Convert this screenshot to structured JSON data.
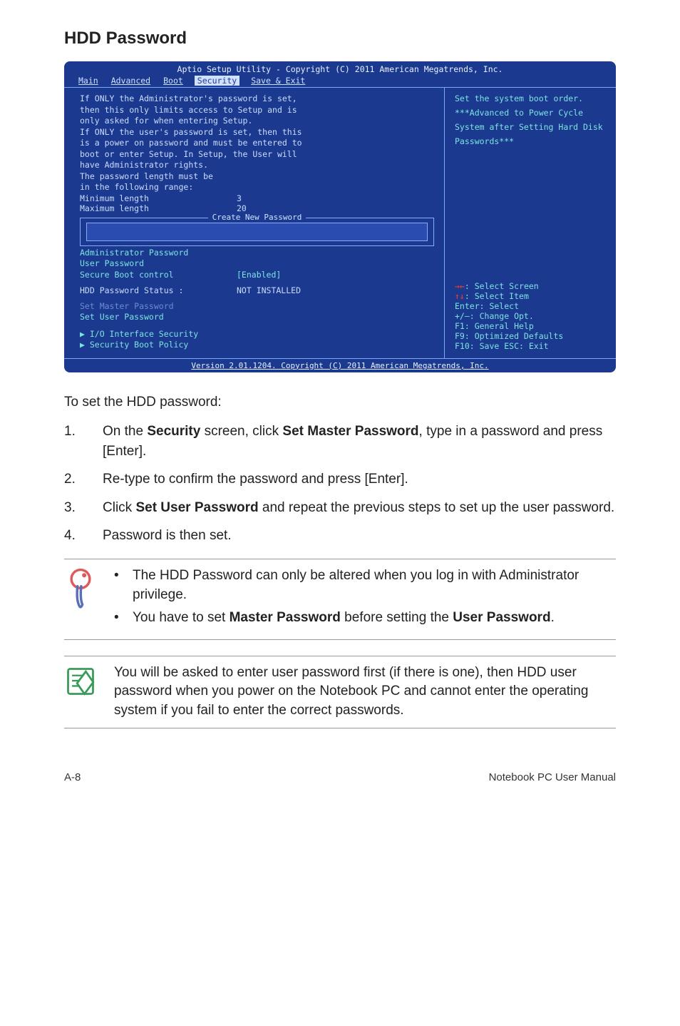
{
  "heading": "HDD Password",
  "bios": {
    "title": "Aptio Setup Utility - Copyright (C) 2011 American Megatrends, Inc.",
    "tabs": [
      "Main",
      "Advanced",
      "Boot",
      "Security",
      "Save & Exit"
    ],
    "active_tab": "Security",
    "info_lines": [
      "If ONLY the Administrator's password is set,",
      "then this only limits access to Setup and is",
      "only asked for when entering Setup.",
      "If ONLY the user's password is set, then this",
      "is a power on password and must be entered to",
      "boot or enter Setup. In Setup, the User will",
      "have Administrator rights.",
      "The password length must be",
      "in the following range:"
    ],
    "min_label": "Minimum length",
    "min_value": "3",
    "max_label": "Maximum length",
    "max_value": "20",
    "dialog_title": "Create New Password",
    "items": {
      "admin_pw": "Administrator Password",
      "user_pw": "User Password",
      "secure_boot_label": "Secure Boot control",
      "secure_boot_value": "[Enabled]",
      "hdd_status_label": "HDD Password Status :",
      "hdd_status_value": "NOT INSTALLED",
      "set_master": "Set Master Password",
      "set_user": "Set User Password",
      "io_security": "I/O Interface Security",
      "boot_policy": "Security Boot Policy"
    },
    "help": {
      "line1": "Set the system boot order.",
      "line2": "***Advanced to Power Cycle",
      "line3": "System after Setting Hard Disk",
      "line4": "Passwords***"
    },
    "keys": {
      "select_screen": "Select Screen",
      "select_item": "Select Item",
      "enter": "Enter: Select",
      "change": "+/—:  Change Opt.",
      "f1": "F1:   General Help",
      "f9": "F9:   Optimized Defaults",
      "f10": "F10:  Save   ESC: Exit"
    },
    "footer": "Version 2.01.1204. Copyright (C) 2011 American Megatrends, Inc."
  },
  "intro": "To set the HDD password:",
  "steps": [
    {
      "num": "1.",
      "pre": "On the ",
      "b1": "Security",
      "mid": " screen, click ",
      "b2": "Set Master Password",
      "post": ", type in a password and press [Enter]."
    },
    {
      "num": "2.",
      "pre": "Re-type to confirm the password and press [Enter].",
      "b1": "",
      "mid": "",
      "b2": "",
      "post": ""
    },
    {
      "num": "3.",
      "pre": "Click ",
      "b1": "Set User Password",
      "mid": " and repeat the previous steps to set up the user password.",
      "b2": "",
      "post": ""
    },
    {
      "num": "4.",
      "pre": "Password is then set.",
      "b1": "",
      "mid": "",
      "b2": "",
      "post": ""
    }
  ],
  "callout1": {
    "bullet1": "The HDD Password can only be altered when you log in with Administrator privilege.",
    "bullet2_pre": "You have to set ",
    "bullet2_b1": "Master Password",
    "bullet2_mid": " before setting the ",
    "bullet2_b2": "User Password",
    "bullet2_post": "."
  },
  "callout2": "You will be asked to enter user password first (if there is one), then HDD user password when you power on the Notebook PC and cannot enter the operating system if you fail to enter the correct passwords.",
  "footer": {
    "left": "A-8",
    "right": "Notebook PC User Manual"
  }
}
